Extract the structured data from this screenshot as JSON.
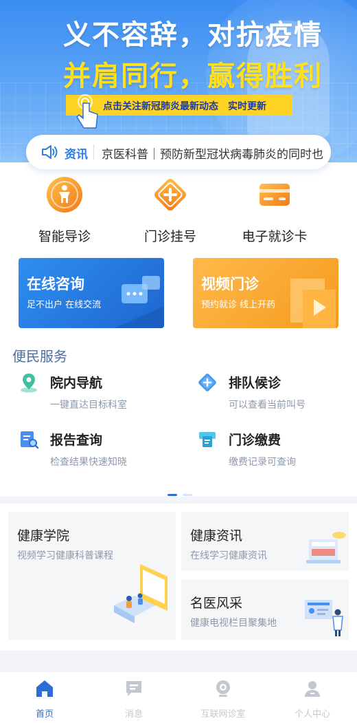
{
  "banner": {
    "headline_line1": "义不容辞，对抗疫情",
    "headline_line2": "并肩同行，赢得胜利",
    "strip_text": "点击关注新冠肺炎最新动态　实时更新"
  },
  "news": {
    "tag": "资讯",
    "text": "京医科普｜预防新型冠状病毒肺炎的同时也"
  },
  "quick_actions": [
    {
      "label": "智能导诊",
      "icon": "guide-person-icon"
    },
    {
      "label": "门诊挂号",
      "icon": "registration-plus-icon"
    },
    {
      "label": "电子就诊卡",
      "icon": "card-icon"
    }
  ],
  "cards": {
    "online": {
      "title": "在线咨询",
      "subtitle": "足不出户  在线交流"
    },
    "video": {
      "title": "视频门诊",
      "subtitle": "预约就诊  线上开药"
    }
  },
  "services": {
    "title": "便民服务",
    "items": [
      {
        "title": "院内导航",
        "subtitle": "一键直达目标科室",
        "icon": "location-pin-icon"
      },
      {
        "title": "排队候诊",
        "subtitle": "可以查看当前叫号",
        "icon": "queue-icon"
      },
      {
        "title": "报告查询",
        "subtitle": "检查结果快速知晓",
        "icon": "report-search-icon"
      },
      {
        "title": "门诊缴费",
        "subtitle": "缴费记录可查询",
        "icon": "payment-icon"
      }
    ],
    "page_index": 1,
    "page_count": 2
  },
  "health": {
    "academy": {
      "title": "健康学院",
      "subtitle": "视频学习健康科普课程"
    },
    "news": {
      "title": "健康资讯",
      "subtitle": "在线学习健康资讯"
    },
    "experts": {
      "title": "名医风采",
      "subtitle": "健康电视栏目聚集地"
    }
  },
  "tabbar": {
    "items": [
      {
        "label": "首页",
        "icon": "home-icon",
        "active": true
      },
      {
        "label": "消息",
        "icon": "message-icon",
        "active": false
      },
      {
        "label": "互联网诊室",
        "icon": "camera-icon",
        "active": false
      },
      {
        "label": "个人中心",
        "icon": "user-icon",
        "active": false
      }
    ]
  },
  "colors": {
    "primary": "#2b6fd6",
    "accent_orange": "#f5a02a",
    "banner_blue": "#3b8df2",
    "banner_yellow": "#ffd324"
  }
}
